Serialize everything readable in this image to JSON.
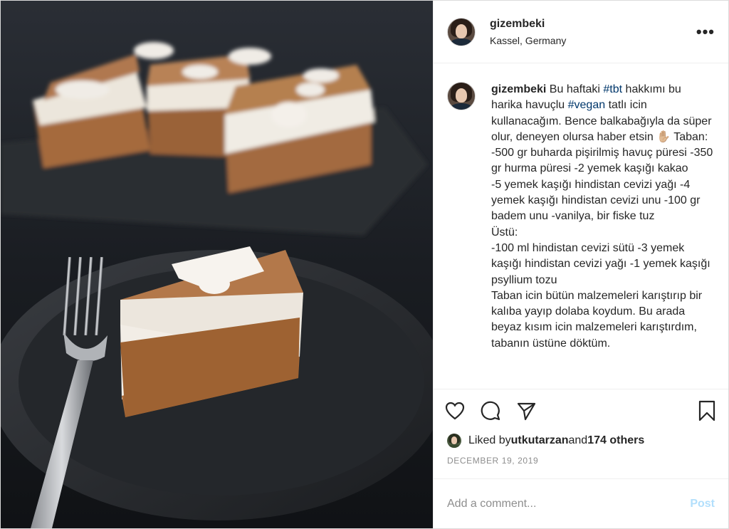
{
  "post": {
    "username": "gizembeki",
    "location": "Kassel, Germany",
    "more_label": "•••",
    "caption": {
      "username": "gizembeki",
      "part1": " Bu haftaki ",
      "tag1": "#tbt",
      "part2": " hakkımı bu harika havuçlu ",
      "tag2": "#vegan",
      "part3": " tatlı icin kullanacağım. Bence balkabağıyla da süper olur, deneyen olursa haber etsin ✋🏼 Taban:\n-500 gr buharda pişirilmiş havuç püresi -350 gr hurma püresi -2 yemek kaşığı kakao\n-5 yemek kaşığı hindistan cevizi yağı -4 yemek kaşığı hindistan cevizi unu -100 gr badem unu -vanilya, bir fiske tuz\nÜstü:\n-100 ml hindistan cevizi sütü -3 yemek kaşığı hindistan cevizi yağı -1 yemek kaşığı psyllium tozu\nTaban icin bütün malzemeleri karıştırıp bir kalıba yayıp dolaba koydum. Bu arada beyaz kısım icin malzemeleri karıştırdım, tabanın üstüne döktüm."
    },
    "likes": {
      "prefix": "Liked by ",
      "user": "utkutarzan",
      "middle": " and ",
      "others": "174 others"
    },
    "date": "DECEMBER 19, 2019",
    "comment": {
      "placeholder": "Add a comment...",
      "post_label": "Post"
    }
  },
  "icons": [
    "more-icon",
    "heart-icon",
    "comment-icon",
    "share-icon",
    "bookmark-icon"
  ],
  "colors": {
    "text": "#262626",
    "muted": "#8e8e8e",
    "hashtag": "#00376b",
    "post_button": "#b2dffc",
    "border": "#efefef"
  }
}
